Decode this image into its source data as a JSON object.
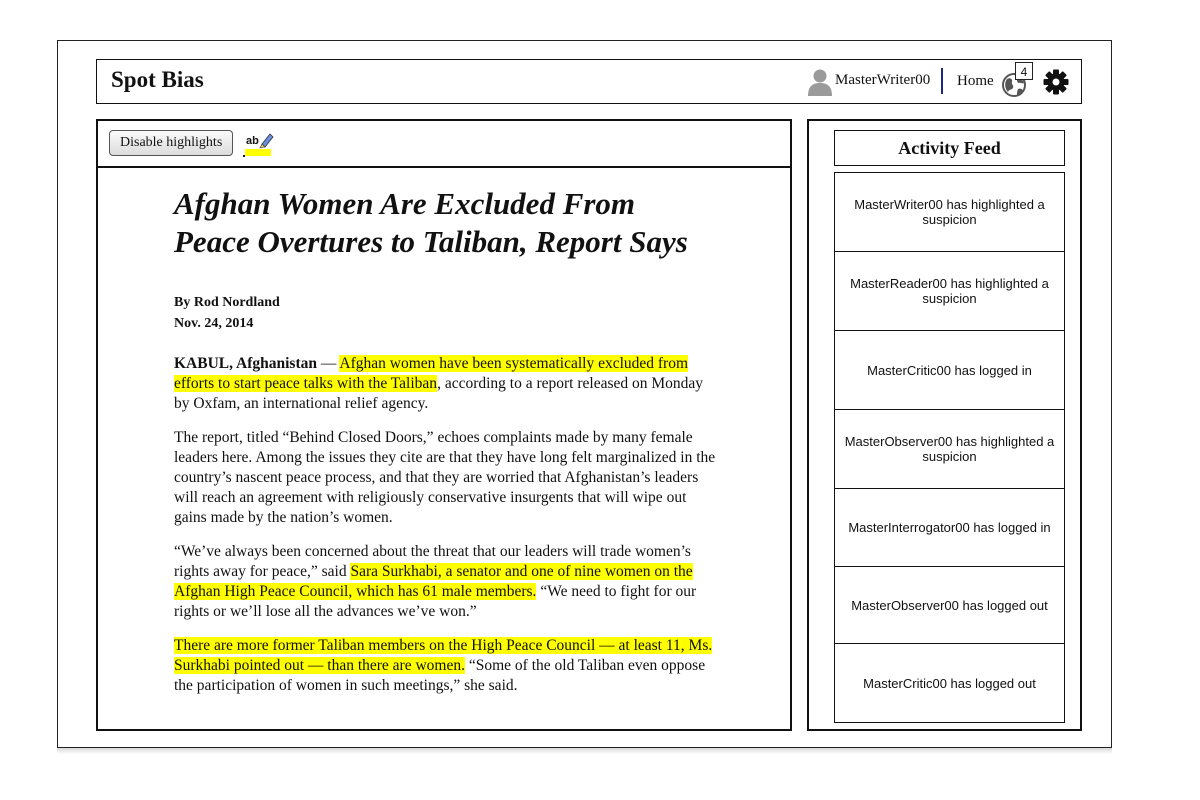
{
  "app": {
    "logo": "Spot Bias",
    "username": "MasterWriter00",
    "home_label": "Home",
    "notification_count": "4"
  },
  "toolbar": {
    "disable_highlights_label": "Disable highlights",
    "highlighter_icon": "highlighter-pen-icon"
  },
  "article": {
    "title_line1": "Afghan Women Are Excluded From",
    "title_line2": "Peace Overtures to Taliban, Report Says",
    "author": "By Rod Nordland",
    "date": "Nov. 24, 2014",
    "p1": {
      "dateline": "KABUL, Afghanistan",
      "dash": " — ",
      "hl": "Afghan women have been systematically excluded from efforts to start peace talks with the Taliban",
      "rest": ", according to a report released on Monday by Oxfam, an international relief agency."
    },
    "p2": "The report, titled “Behind Closed Doors,” echoes complaints made by many female leaders here. Among the issues they cite are that they have long felt marginalized in the country’s nascent peace process, and that they are worried that Afghanistan’s leaders will reach an agreement with religiously conservative insurgents that will wipe out gains made by the nation’s women.",
    "p3": {
      "pre": "“We’ve always been concerned about the threat that our leaders will trade women’s rights away for peace,” said ",
      "hl": "Sara Surkhabi, a senator and one of nine women on the Afghan High Peace Council, which has 61 male members.",
      "post": " “We need to fight for our rights or we’ll lose all the advances we’ve won.”"
    },
    "p4": {
      "hl": "There are more former Taliban members on the High Peace Council — at least 11, Ms. Surkhabi pointed out — than there are women.",
      "post": " “Some of the old Taliban even oppose the participation of women in such meetings,” she said."
    }
  },
  "feed": {
    "title": "Activity Feed",
    "items": [
      "MasterWriter00 has highlighted a suspicion",
      "MasterReader00 has highlighted a suspicion",
      "MasterCritic00 has logged in",
      "MasterObserver00 has highlighted a suspicion",
      "MasterInterrogator00 has logged in",
      "MasterObserver00 has logged out",
      "MasterCritic00 has logged out"
    ]
  },
  "colors": {
    "highlight": "#ffff00",
    "divider": "#1a2a80"
  }
}
